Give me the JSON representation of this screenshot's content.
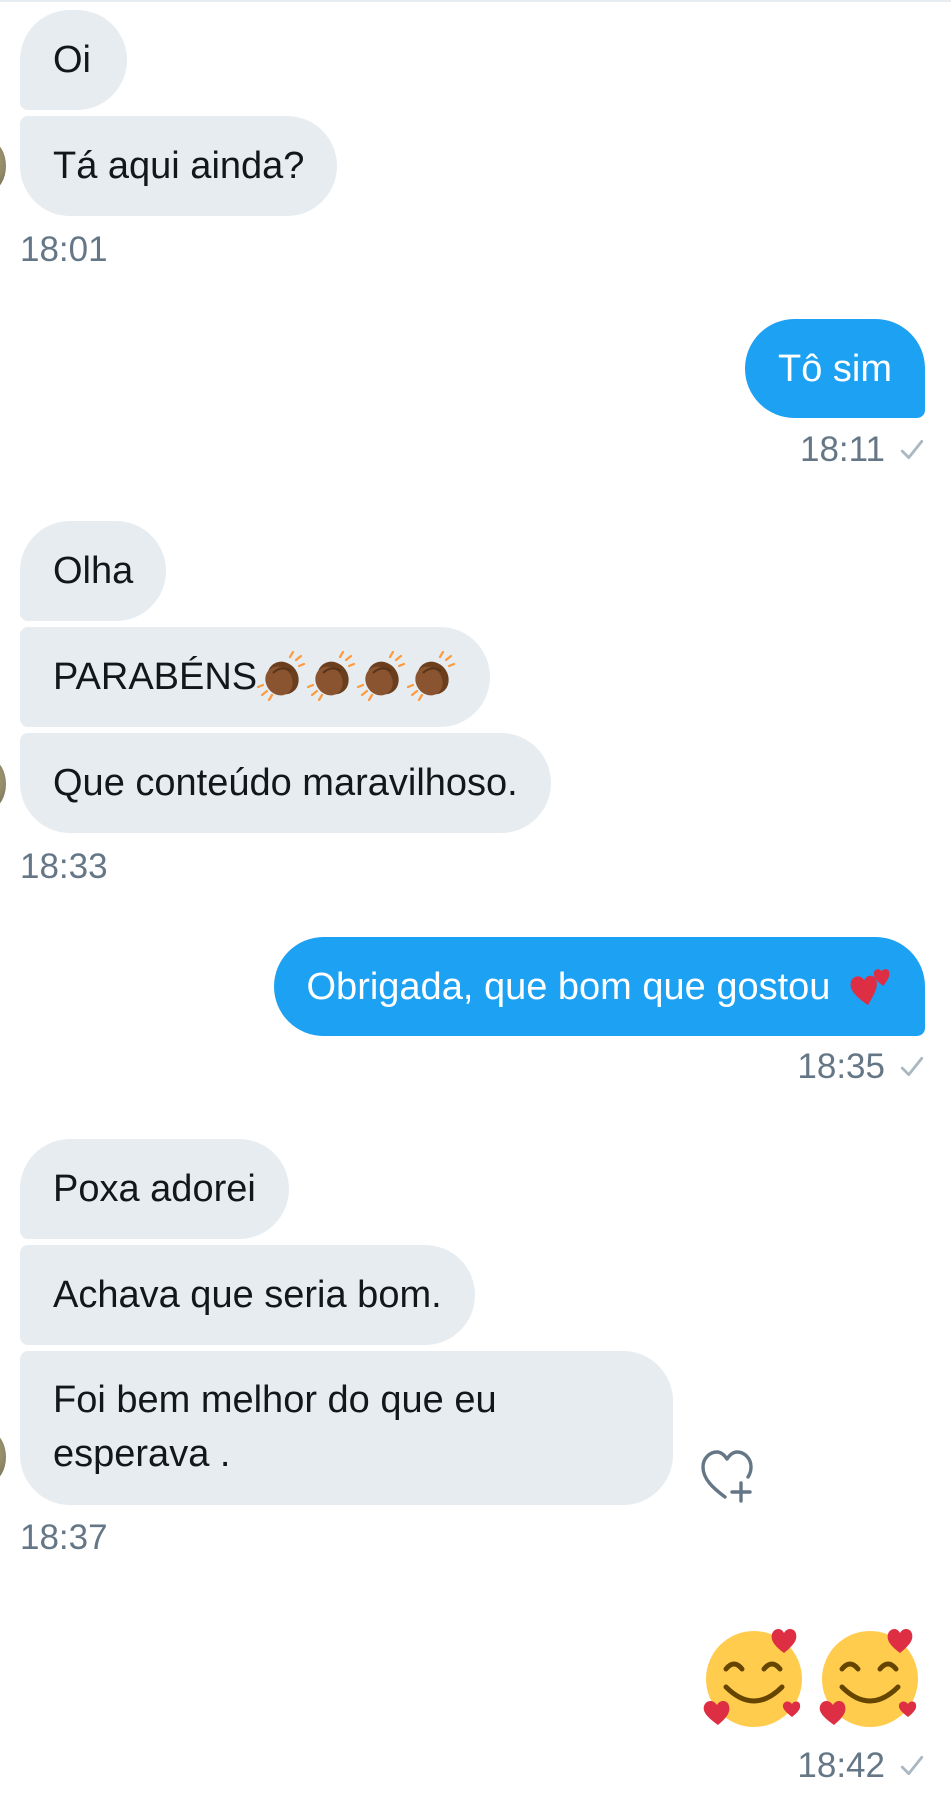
{
  "messages": {
    "m1": {
      "text": "Oi"
    },
    "m2": {
      "text": "Tá aqui ainda?"
    },
    "t1": {
      "time": "18:01"
    },
    "m3": {
      "text": "Tô sim"
    },
    "t2": {
      "time": "18:11"
    },
    "m4": {
      "text": "Olha"
    },
    "m5": {
      "text": "PARABÉNS",
      "emoji": "clapping-hands-medium-dark-skin x4"
    },
    "m6": {
      "text": "Que conteúdo maravilhoso."
    },
    "t3": {
      "time": "18:33"
    },
    "m7": {
      "text": "Obrigada, que bom que gostou",
      "emoji": "two-hearts"
    },
    "t4": {
      "time": "18:35"
    },
    "m8": {
      "text": "Poxa adorei"
    },
    "m9": {
      "text": "Achava que seria bom."
    },
    "m10": {
      "line1": "Foi bem melhor do que eu",
      "line2": "esperava ."
    },
    "t5": {
      "time": "18:37"
    },
    "m11": {
      "emoji": "smiling-face-with-hearts x2"
    },
    "t6": {
      "time": "18:42"
    }
  },
  "icons": {
    "check": "check-icon",
    "like": "heart-plus-icon"
  },
  "colors": {
    "incoming_bg": "#e6ecf0",
    "outgoing_bg": "#1da1f2",
    "incoming_text": "#14171a",
    "timestamp": "#657786"
  }
}
